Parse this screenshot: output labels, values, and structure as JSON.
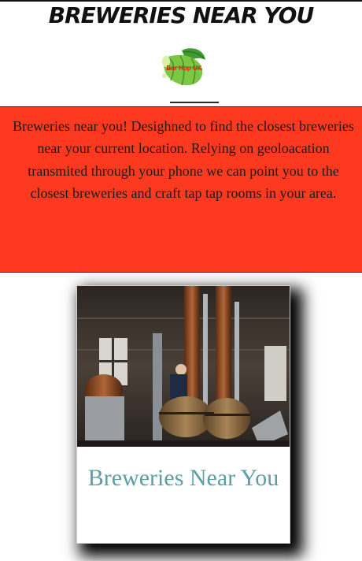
{
  "header": {
    "title": "Breweries Near You"
  },
  "logo": {
    "text": "Bar Hop UK",
    "icon": "hop-cone-icon"
  },
  "banner": {
    "description": "Breweries near you! Desighned to find the closest breweries near your current location. Relying on geoloacation transmited through your phone we can point you to the closest breweries and craft tap tap rooms in your area.",
    "color": "#fd3a1f"
  },
  "card": {
    "title": "Breweries Near You",
    "image": "brewery-distillery-photo",
    "title_color": "#5b9ea3"
  }
}
